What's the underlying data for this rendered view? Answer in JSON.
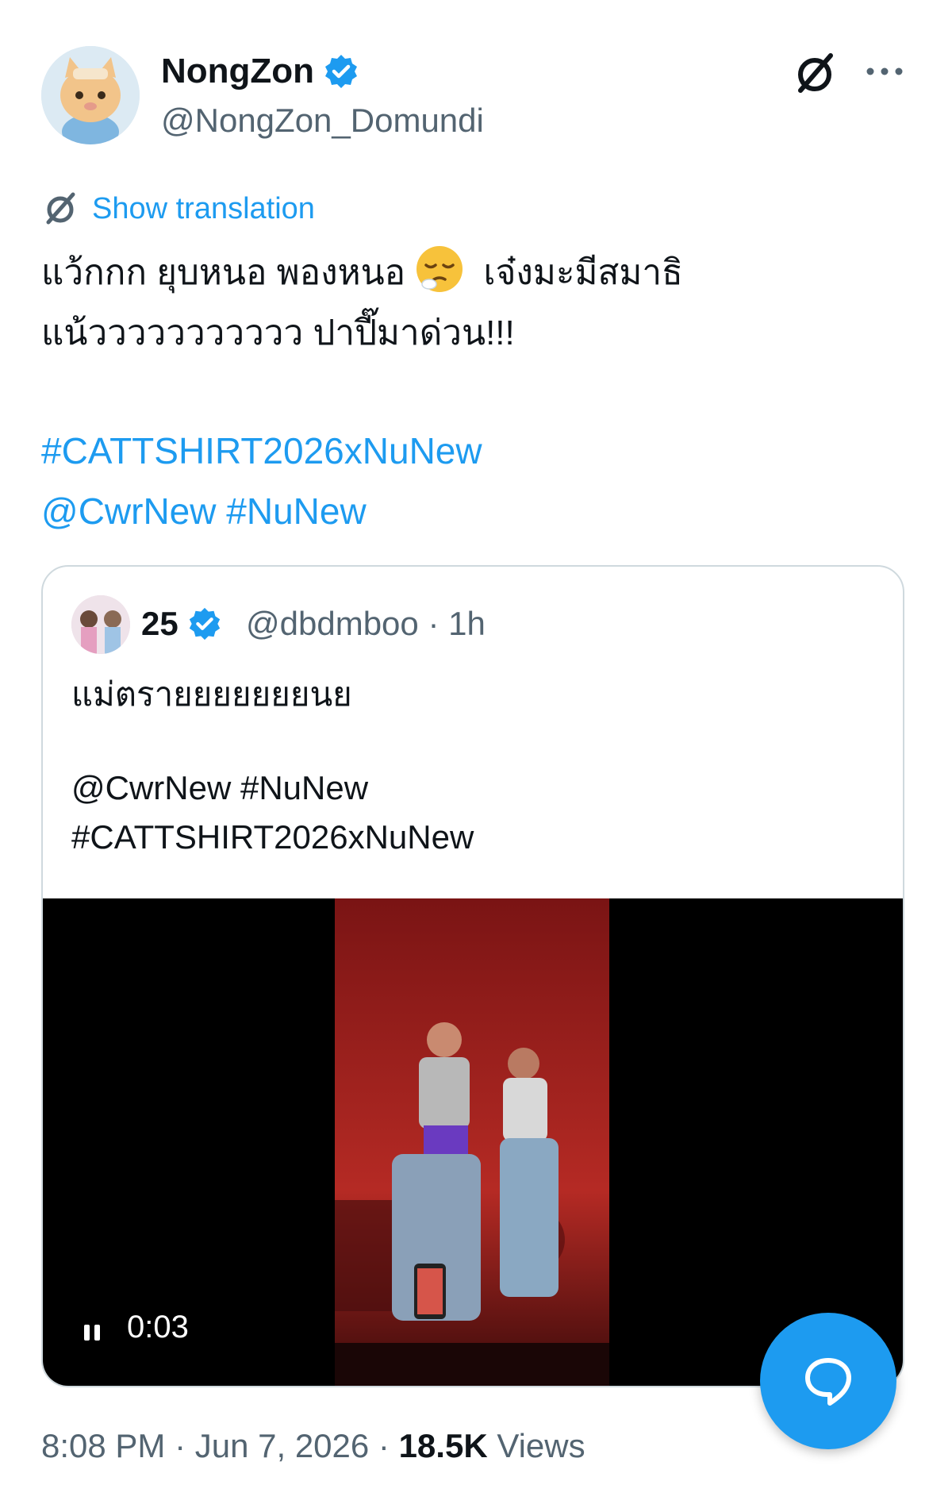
{
  "tweet": {
    "author": {
      "display_name": "NongZon",
      "handle": "@NongZon_Domundi",
      "verified": true
    },
    "show_translation_label": "Show translation",
    "text": {
      "line1_before_emoji": "แว้กกก ยุบหนอ พองหนอ",
      "emoji": "sleepy-face",
      "line1_after_emoji": "เจ๋งมะมีสมาธิ",
      "line2": "แน้ววววววววววว ปาปี๊มาด่วน!!!"
    },
    "hashtag_line": "#CATTSHIRT2026xNuNew",
    "mention_line": {
      "mention": "@CwrNew",
      "hashtag": "#NuNew"
    },
    "timestamp": "8:08 PM · Jun 7, 2026 · ",
    "views_count": "18.5K",
    "views_label": " Views"
  },
  "quoted_tweet": {
    "display_name": "25",
    "handle_time": "@dbdmboo · 1h",
    "verified": true,
    "text": "แม่ตรายยยยยยยนย",
    "mention_line": "@CwrNew #NuNew",
    "hashtag_line": "#CATTSHIRT2026xNuNew",
    "video": {
      "elapsed": "0:03",
      "state": "playing"
    }
  },
  "colors": {
    "accent": "#1d9bf0",
    "text_primary": "#0f1419",
    "text_secondary": "#536471",
    "border": "#cfd9de"
  },
  "icons": {
    "translate": "translate-globe-icon",
    "more": "more-horizontal-icon",
    "verified": "verified-badge-icon",
    "pause": "pause-icon",
    "compose": "reply-bubble-icon"
  }
}
